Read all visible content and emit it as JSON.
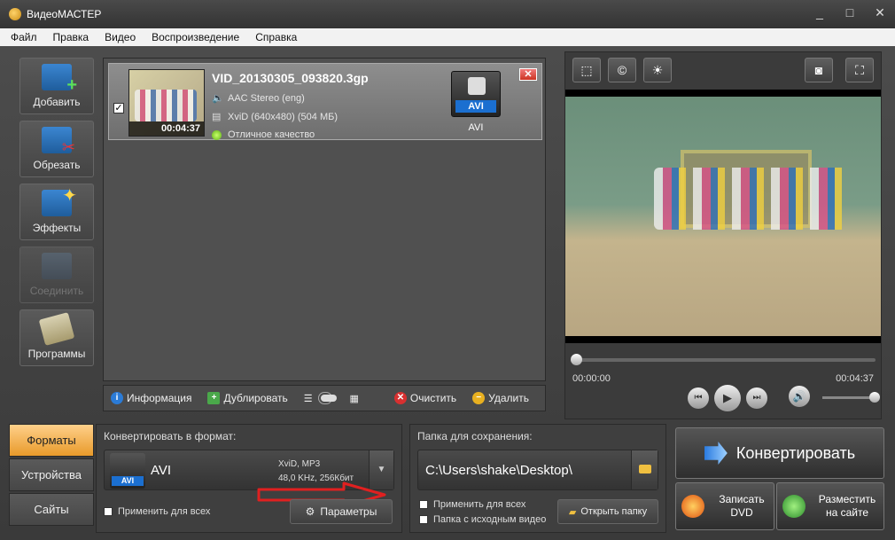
{
  "window": {
    "title": "ВидеоМАСТЕР",
    "minimize": "_",
    "maximize": "□",
    "close": "✕"
  },
  "menu": [
    "Файл",
    "Правка",
    "Видео",
    "Воспроизведение",
    "Справка"
  ],
  "left_tools": [
    {
      "label": "Добавить",
      "icon": "add-video-icon",
      "enabled": true
    },
    {
      "label": "Обрезать",
      "icon": "cut-icon",
      "enabled": true
    },
    {
      "label": "Эффекты",
      "icon": "effects-icon",
      "enabled": true
    },
    {
      "label": "Соединить",
      "icon": "join-icon",
      "enabled": false
    },
    {
      "label": "Программы",
      "icon": "programs-icon",
      "enabled": true
    }
  ],
  "file_item": {
    "checked": true,
    "filename": "VID_20130305_093820.3gp",
    "duration": "00:04:37",
    "audio": "AAC Stereo (eng)",
    "video": "XviD (640x480) (504 МБ)",
    "quality": "Отличное качество",
    "format_badge": "AVI",
    "format_name": "AVI"
  },
  "file_actions": {
    "info": "Информация",
    "duplicate": "Дублировать",
    "clear": "Очистить",
    "delete": "Удалить"
  },
  "preview": {
    "current_time": "00:00:00",
    "total_time": "00:04:37",
    "progress": 0,
    "volume": 1.0
  },
  "bottom_tabs": [
    {
      "label": "Форматы",
      "active": true
    },
    {
      "label": "Устройства",
      "active": false
    },
    {
      "label": "Сайты",
      "active": false
    }
  ],
  "format_panel": {
    "label": "Конвертировать в формат:",
    "badge": "AVI",
    "value": "AVI",
    "spec_line1": "XviD, MP3",
    "spec_line2": "48,0 KHz, 256Кбит",
    "apply_all": "Применить для всех",
    "params": "Параметры"
  },
  "save_panel": {
    "label": "Папка для сохранения:",
    "path": "C:\\Users\\shake\\Desktop\\",
    "apply_all": "Применить для всех",
    "source_folder": "Папка с исходным видео",
    "open_folder": "Открыть папку"
  },
  "actions": {
    "convert": "Конвертировать",
    "dvd_line1": "Записать",
    "dvd_line2": "DVD",
    "site_line1": "Разместить",
    "site_line2": "на сайте"
  },
  "colors": {
    "accent_tab": "#e89a2a",
    "badge_blue": "#1b6fd0",
    "annotation": "#e02020"
  }
}
